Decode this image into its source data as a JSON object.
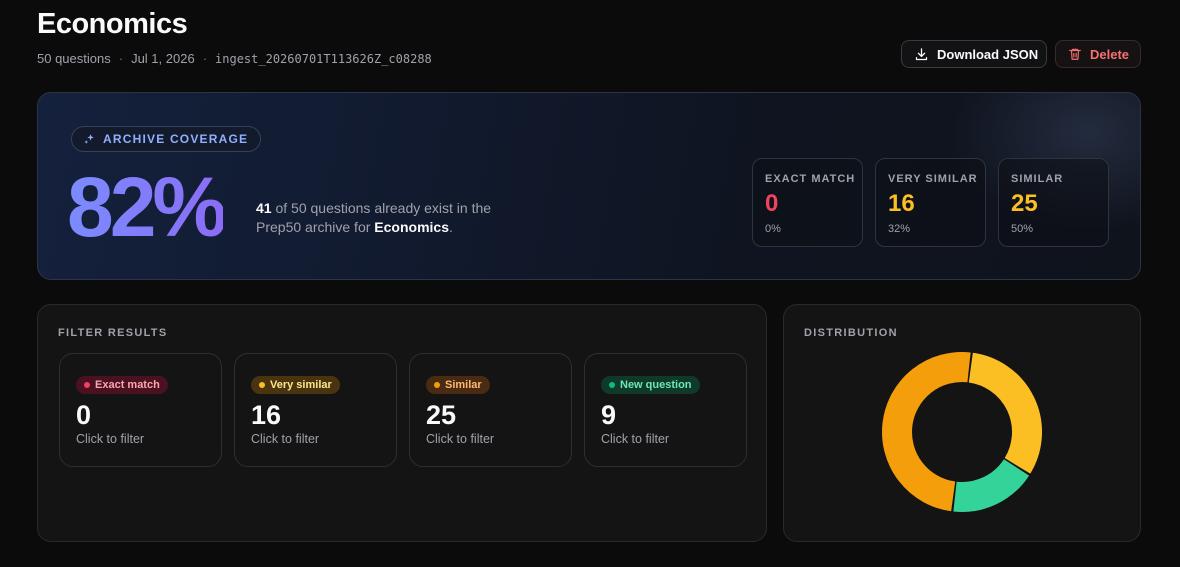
{
  "header": {
    "title": "Economics",
    "question_count": "50 questions",
    "date": "Jul 1, 2026",
    "ingest_id": "ingest_20260701T113626Z_c08288",
    "separator": "·",
    "download_label": "Download JSON",
    "delete_label": "Delete"
  },
  "coverage": {
    "badge_label": "ARCHIVE COVERAGE",
    "percent": "82%",
    "count": "41",
    "text_middle": " of 50 questions already exist in the Prep50 archive for ",
    "subject": "Economics",
    "text_end": ".",
    "stats": [
      {
        "label": "EXACT MATCH",
        "value": "0",
        "percent": "0%",
        "color": "#f0435c"
      },
      {
        "label": "VERY SIMILAR",
        "value": "16",
        "percent": "32%",
        "color": "#fbbf24"
      },
      {
        "label": "SIMILAR",
        "value": "25",
        "percent": "50%",
        "color": "#fbbf24"
      }
    ]
  },
  "filters": {
    "title": "FILTER RESULTS",
    "cards": [
      {
        "label": "Exact match",
        "value": "0",
        "hint": "Click to filter",
        "dot": "#f43f5e",
        "pill_bg": "#4a1220",
        "pill_fg": "#fda4af"
      },
      {
        "label": "Very similar",
        "value": "16",
        "hint": "Click to filter",
        "dot": "#fbbf24",
        "pill_bg": "#4a3410",
        "pill_fg": "#fde68a"
      },
      {
        "label": "Similar",
        "value": "25",
        "hint": "Click to filter",
        "dot": "#f59e0b",
        "pill_bg": "#4a2a10",
        "pill_fg": "#fdba74"
      },
      {
        "label": "New question",
        "value": "9",
        "hint": "Click to filter",
        "dot": "#10b981",
        "pill_bg": "#0f3a2a",
        "pill_fg": "#6ee7b7"
      }
    ]
  },
  "distribution": {
    "title": "DISTRIBUTION",
    "segments": [
      {
        "key": "very-similar",
        "value": 16,
        "color": "#fbbf24"
      },
      {
        "key": "new-question",
        "value": 9,
        "color": "#34d399"
      },
      {
        "key": "similar",
        "value": 25,
        "color": "#f59e0b"
      },
      {
        "key": "exact-match",
        "value": 0,
        "color": "#f0435c"
      }
    ]
  }
}
